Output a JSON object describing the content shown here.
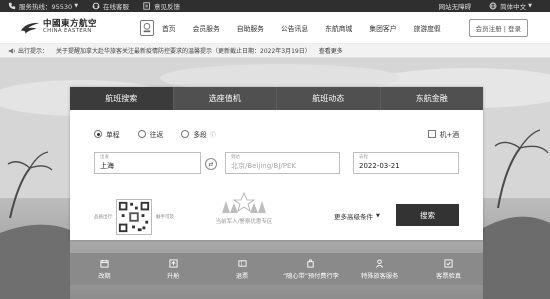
{
  "topbar": {
    "hotline_label": "服务热线：95530",
    "online_service": "在线客服",
    "feedback": "意见反馈",
    "accessibility": "网站无障碍",
    "language": "简体中文"
  },
  "header": {
    "logo_cn": "中國東方航空",
    "logo_en": "CHINA EASTERN",
    "badge_text": "",
    "nav": [
      "首页",
      "会员服务",
      "自助服务",
      "公告讯息",
      "东航商城",
      "集团客户",
      "旅游度假"
    ],
    "login": "会员注册 | 登录"
  },
  "notice": {
    "label": "出行提示：",
    "text": "关于提醒加拿大赴华旅客关注最新疫情防控要求的温馨提示（更新截止日期：2022年3月19日）",
    "more": "查看更多"
  },
  "booking": {
    "tabs": [
      "航班搜索",
      "选座值机",
      "航班动态",
      "东航金融"
    ],
    "active_tab": 0,
    "trip_types": [
      "单程",
      "往返",
      "多段"
    ],
    "selected_trip": 0,
    "plus_hotel": "机+酒",
    "from_label": "出发",
    "from_value": "上海",
    "to_label": "到达",
    "to_placeholder": "北京/Beijing/BJ/PEK",
    "date_label": "去程",
    "date_value": "2022-03-21",
    "qr_left": "品质出行",
    "qr_right": "触手可及",
    "promo_text": "当前军人/警察优惠专区",
    "advanced": "更多高级条件",
    "search": "搜索"
  },
  "quick_services": [
    {
      "label": "改期",
      "icon": "calendar-icon"
    },
    {
      "label": "升舱",
      "icon": "upgrade-icon"
    },
    {
      "label": "退票",
      "icon": "ticket-icon"
    },
    {
      "label": "“随心带”预付费行李",
      "icon": "luggage-icon"
    },
    {
      "label": "特殊旅客服务",
      "icon": "person-icon"
    },
    {
      "label": "客票验真",
      "icon": "verify-icon"
    }
  ],
  "colors": {
    "topbar_bg": "#2f2f2f",
    "tab_bg": "#505050",
    "active_tab_bg": "#3b3b3b",
    "search_button": "#333333",
    "quick_bar_bg": "#8a8a8a"
  }
}
